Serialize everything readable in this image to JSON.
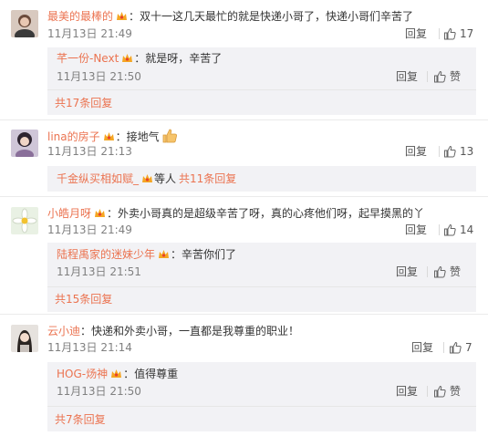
{
  "comments": [
    {
      "user": "最美的最棒的",
      "text": "：双十一这几天最忙的就是快递小哥了，快递小哥们辛苦了",
      "time": "11月13日 21:49",
      "reply_label": "回复",
      "likes": "17",
      "reply": {
        "user": "芊一份-Next",
        "text": "：就是呀，辛苦了",
        "time": "11月13日 21:50",
        "reply_label": "回复",
        "like_label": "赞"
      },
      "more": "共17条回复"
    },
    {
      "user": "lina的房子",
      "text": "：接地气",
      "time": "11月13日 21:13",
      "reply_label": "回复",
      "likes": "13",
      "reply_inline": {
        "user": "千金纵买相如赋_",
        "mid": "等人",
        "more": "共11条回复"
      }
    },
    {
      "user": "小皓月呀",
      "text": "：外卖小哥真的是超级辛苦了呀，真的心疼他们呀，起早摸黑的丫",
      "time": "11月13日 21:49",
      "reply_label": "回复",
      "likes": "14",
      "reply": {
        "user": "陆程禹家的迷妹少年",
        "text": "：辛苦你们了",
        "time": "11月13日 21:51",
        "reply_label": "回复",
        "like_label": "赞"
      },
      "more": "共15条回复"
    },
    {
      "user": "云小迪",
      "text": "：快递和外卖小哥，一直都是我尊重的职业！",
      "time": "11月13日 21:14",
      "reply_label": "回复",
      "likes": "7",
      "reply": {
        "user": "HOG-炀神",
        "text": "：值得尊重",
        "time": "11月13日 21:50",
        "reply_label": "回复",
        "like_label": "赞"
      },
      "more": "共7条回复"
    }
  ],
  "icons": {
    "like": "thumbs-up-icon",
    "badge": "vip-crown-badge-icon",
    "emoji": "thumbs-up-emoji-icon"
  },
  "colors": {
    "username": "#eb7350",
    "subbox_bg": "#f2f2f5",
    "meta": "#808080"
  }
}
